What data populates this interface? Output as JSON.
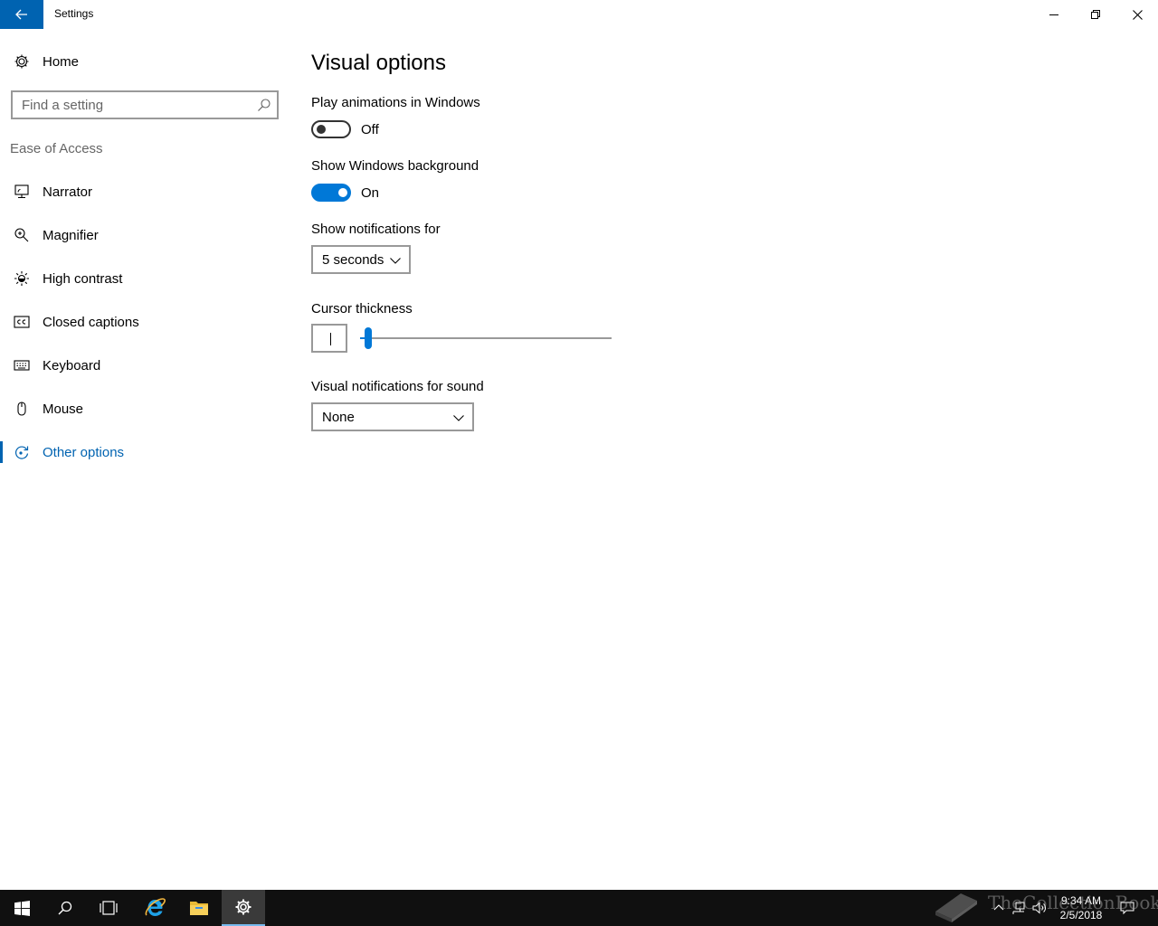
{
  "window": {
    "title": "Settings"
  },
  "sidebar": {
    "home_label": "Home",
    "search_placeholder": "Find a setting",
    "section_label": "Ease of Access",
    "items": [
      {
        "label": "Narrator",
        "icon": "narrator-icon"
      },
      {
        "label": "Magnifier",
        "icon": "magnifier-icon"
      },
      {
        "label": "High contrast",
        "icon": "high-contrast-icon"
      },
      {
        "label": "Closed captions",
        "icon": "closed-captions-icon"
      },
      {
        "label": "Keyboard",
        "icon": "keyboard-icon"
      },
      {
        "label": "Mouse",
        "icon": "mouse-icon"
      },
      {
        "label": "Other options",
        "icon": "other-options-icon",
        "active": true
      }
    ]
  },
  "main": {
    "title": "Visual options",
    "play_animations": {
      "label": "Play animations in Windows",
      "state": "Off"
    },
    "show_background": {
      "label": "Show Windows background",
      "state": "On"
    },
    "notifications": {
      "label": "Show notifications for",
      "value": "5 seconds"
    },
    "cursor": {
      "label": "Cursor thickness",
      "level": 0.02
    },
    "visual_sound": {
      "label": "Visual notifications for sound",
      "value": "None"
    }
  },
  "taskbar": {
    "time": "9:34 AM",
    "date": "2/5/2018",
    "watermark": "TheCollectionBook"
  },
  "colors": {
    "accent": "#0078d7",
    "back_button": "#0063b1",
    "taskbar": "#101010"
  }
}
